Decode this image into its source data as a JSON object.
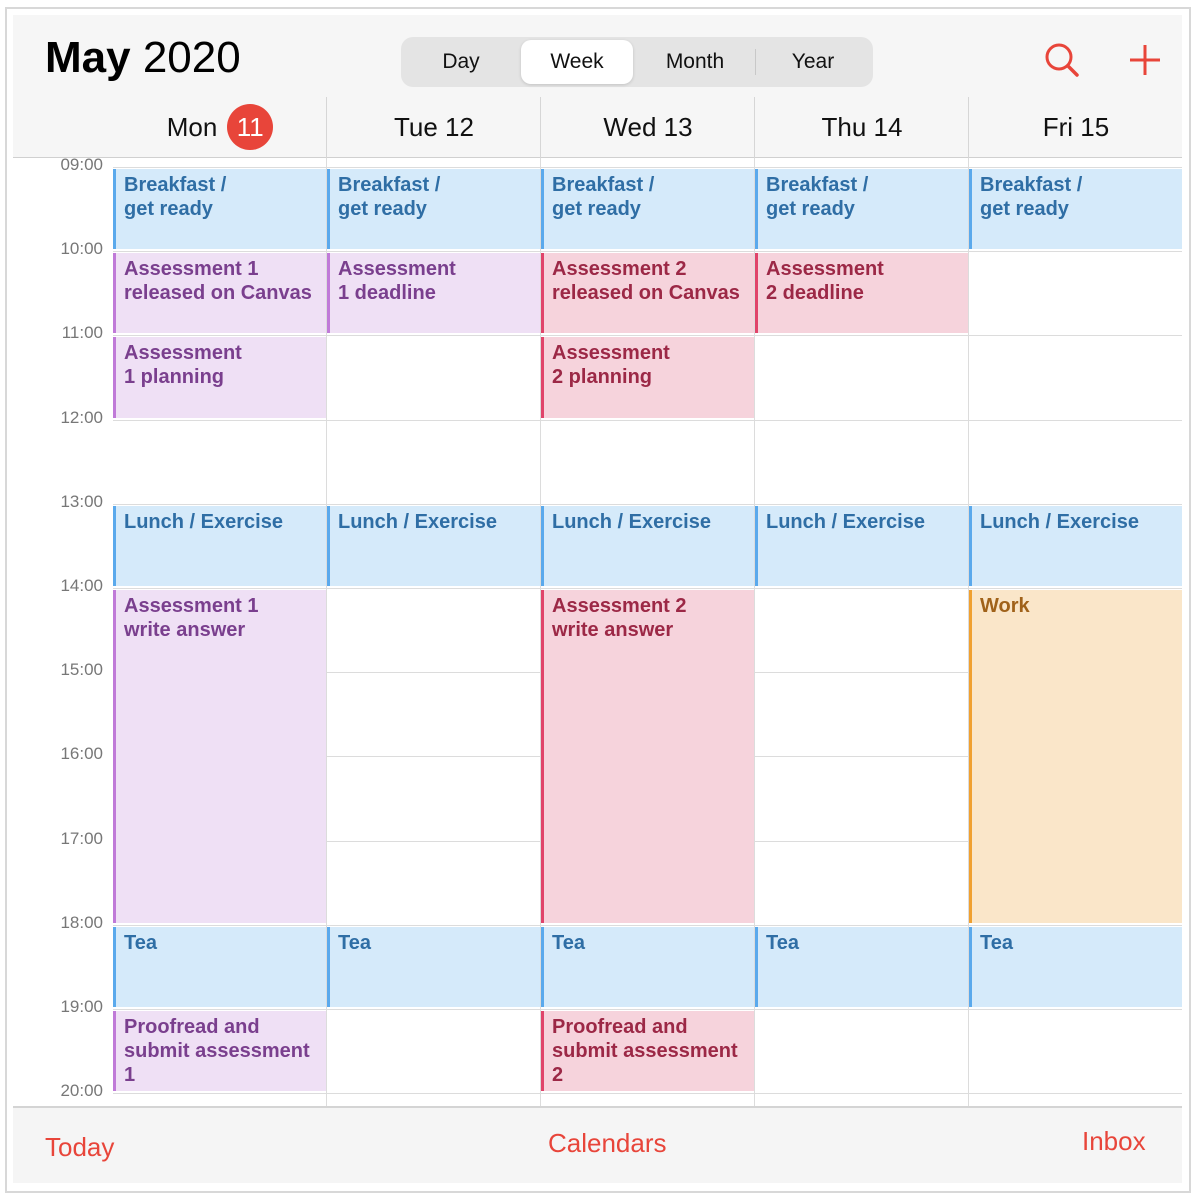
{
  "header": {
    "month": "May",
    "year": "2020",
    "segments": [
      "Day",
      "Week",
      "Month",
      "Year"
    ],
    "active_segment": "Week",
    "search_icon": "magnifying-glass",
    "add_icon": "plus"
  },
  "days": [
    {
      "label": "Mon",
      "date": "11",
      "today": true
    },
    {
      "label": "Tue 12"
    },
    {
      "label": "Wed 13"
    },
    {
      "label": "Thu 14"
    },
    {
      "label": "Fri 15"
    }
  ],
  "hours": [
    "09:00",
    "10:00",
    "11:00",
    "12:00",
    "13:00",
    "14:00",
    "15:00",
    "16:00",
    "17:00",
    "18:00",
    "19:00",
    "20:00"
  ],
  "colors": {
    "blue": {
      "bg": "#d5eafa",
      "border": "#5aa9ec",
      "text": "#2f6ea5"
    },
    "purple": {
      "bg": "#efe0f5",
      "border": "#c07ad8",
      "text": "#7a3f8e"
    },
    "pink": {
      "bg": "#f6d3dc",
      "border": "#e0446a",
      "text": "#9c2846"
    },
    "orange": {
      "bg": "#fae6c9",
      "border": "#f0a030",
      "text": "#a0621a"
    },
    "accent": "#e8453a"
  },
  "events": [
    {
      "day": 0,
      "start": 9,
      "end": 10,
      "title": "Breakfast /\nget ready",
      "color": "blue"
    },
    {
      "day": 1,
      "start": 9,
      "end": 10,
      "title": "Breakfast /\nget ready",
      "color": "blue"
    },
    {
      "day": 2,
      "start": 9,
      "end": 10,
      "title": "Breakfast /\nget ready",
      "color": "blue"
    },
    {
      "day": 3,
      "start": 9,
      "end": 10,
      "title": "Breakfast /\nget ready",
      "color": "blue"
    },
    {
      "day": 4,
      "start": 9,
      "end": 10,
      "title": "Breakfast /\nget ready",
      "color": "blue"
    },
    {
      "day": 0,
      "start": 10,
      "end": 11,
      "title": "Assessment 1\nreleased on Canvas",
      "color": "purple"
    },
    {
      "day": 1,
      "start": 10,
      "end": 11,
      "title": "Assessment\n1 deadline",
      "color": "purple"
    },
    {
      "day": 2,
      "start": 10,
      "end": 11,
      "title": "Assessment 2\nreleased on Canvas",
      "color": "pink"
    },
    {
      "day": 3,
      "start": 10,
      "end": 11,
      "title": "Assessment\n2 deadline",
      "color": "pink"
    },
    {
      "day": 0,
      "start": 11,
      "end": 12,
      "title": "Assessment\n1 planning",
      "color": "purple"
    },
    {
      "day": 2,
      "start": 11,
      "end": 12,
      "title": "Assessment\n2 planning",
      "color": "pink"
    },
    {
      "day": 0,
      "start": 13,
      "end": 14,
      "title": "Lunch / Exercise",
      "color": "blue"
    },
    {
      "day": 1,
      "start": 13,
      "end": 14,
      "title": "Lunch / Exercise",
      "color": "blue"
    },
    {
      "day": 2,
      "start": 13,
      "end": 14,
      "title": "Lunch / Exercise",
      "color": "blue"
    },
    {
      "day": 3,
      "start": 13,
      "end": 14,
      "title": "Lunch / Exercise",
      "color": "blue"
    },
    {
      "day": 4,
      "start": 13,
      "end": 14,
      "title": "Lunch / Exercise",
      "color": "blue"
    },
    {
      "day": 0,
      "start": 14,
      "end": 18,
      "title": "Assessment 1\nwrite answer",
      "color": "purple"
    },
    {
      "day": 2,
      "start": 14,
      "end": 18,
      "title": "Assessment 2\nwrite answer",
      "color": "pink"
    },
    {
      "day": 4,
      "start": 14,
      "end": 18,
      "title": "Work",
      "color": "orange"
    },
    {
      "day": 0,
      "start": 18,
      "end": 19,
      "title": "Tea",
      "color": "blue"
    },
    {
      "day": 1,
      "start": 18,
      "end": 19,
      "title": "Tea",
      "color": "blue"
    },
    {
      "day": 2,
      "start": 18,
      "end": 19,
      "title": "Tea",
      "color": "blue"
    },
    {
      "day": 3,
      "start": 18,
      "end": 19,
      "title": "Tea",
      "color": "blue"
    },
    {
      "day": 4,
      "start": 18,
      "end": 19,
      "title": "Tea",
      "color": "blue"
    },
    {
      "day": 0,
      "start": 19,
      "end": 20,
      "title": "Proofread and\nsubmit assessment\n1",
      "color": "purple"
    },
    {
      "day": 2,
      "start": 19,
      "end": 20,
      "title": "Proofread and\nsubmit assessment\n2",
      "color": "pink"
    }
  ],
  "footer": {
    "today": "Today",
    "calendars": "Calendars",
    "inbox": "Inbox"
  }
}
